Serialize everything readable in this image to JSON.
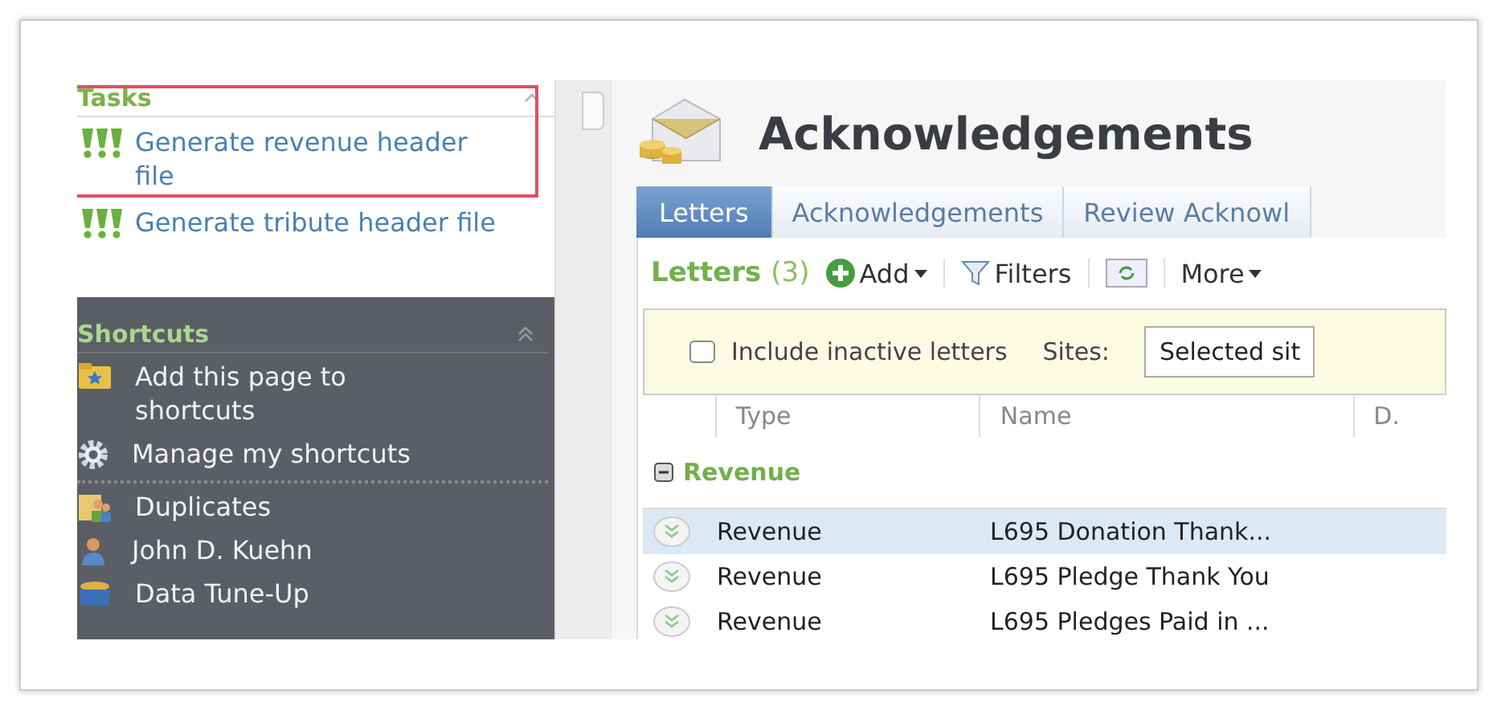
{
  "sidebar": {
    "tasks": {
      "title": "Tasks",
      "items": [
        {
          "label": "Generate revenue header file",
          "highlighted": true
        },
        {
          "label": "Generate tribute header file",
          "highlighted": false
        }
      ]
    },
    "shortcuts": {
      "title": "Shortcuts",
      "items": [
        {
          "label": "Add this page to shortcuts",
          "kind": "folder",
          "divider_after": false
        },
        {
          "label": "Manage my shortcuts",
          "kind": "gear",
          "divider_after": true
        },
        {
          "label": "Duplicates",
          "kind": "people",
          "divider_after": false
        },
        {
          "label": "John D. Kuehn",
          "kind": "person",
          "divider_after": false
        },
        {
          "label": "Data Tune-Up",
          "kind": "database",
          "divider_after": false
        }
      ]
    }
  },
  "page": {
    "title": "Acknowledgements",
    "tabs": [
      {
        "label": "Letters",
        "selected": true
      },
      {
        "label": "Acknowledgements",
        "selected": false
      },
      {
        "label": "Review Acknowl",
        "selected": false
      }
    ],
    "toolbar": {
      "title": "Letters",
      "count": "(3)",
      "add": "Add",
      "filters": "Filters",
      "more": "More"
    },
    "filter_bar": {
      "checkbox_label": "Include inactive letters",
      "checked": false,
      "sites_label": "Sites:",
      "sites_value": "Selected sit"
    },
    "table": {
      "columns": [
        "Type",
        "Name",
        "D."
      ],
      "group": {
        "label": "Revenue",
        "expanded": true
      },
      "rows": [
        {
          "type": "Revenue",
          "name": "L695 Donation Thank...",
          "selected": true
        },
        {
          "type": "Revenue",
          "name": "L695 Pledge Thank You",
          "selected": false
        },
        {
          "type": "Revenue",
          "name": "L695 Pledges Paid in ...",
          "selected": false
        }
      ]
    }
  }
}
